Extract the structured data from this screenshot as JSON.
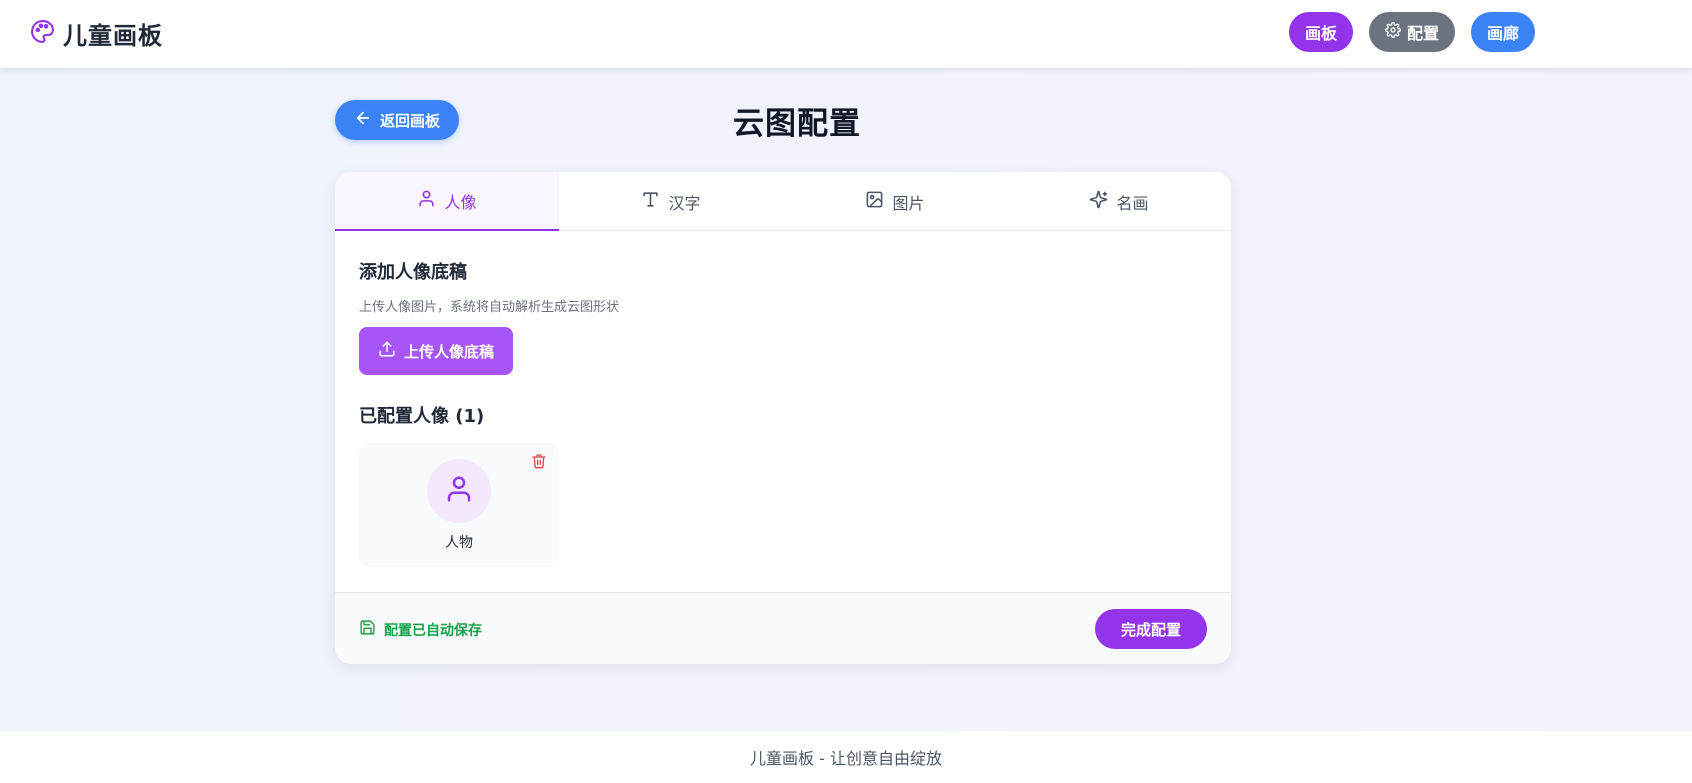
{
  "header": {
    "brand": "儿童画板",
    "nav": {
      "board": "画板",
      "config": "配置",
      "gallery": "画廊"
    }
  },
  "page": {
    "back_label": "返回画板",
    "title": "云图配置"
  },
  "tabs": [
    {
      "label": "人像",
      "icon": "user-icon",
      "active": true
    },
    {
      "label": "汉字",
      "icon": "type-icon",
      "active": false
    },
    {
      "label": "图片",
      "icon": "image-icon",
      "active": false
    },
    {
      "label": "名画",
      "icon": "sparkles-icon",
      "active": false
    }
  ],
  "portrait": {
    "add_title": "添加人像底稿",
    "add_desc": "上传人像图片，系统将自动解析生成云图形状",
    "upload_label": "上传人像底稿",
    "configured_title": "已配置人像 (1)",
    "items": [
      {
        "label": "人物"
      }
    ]
  },
  "footer_bar": {
    "saved_text": "配置已自动保存",
    "done_label": "完成配置"
  },
  "page_footer": "儿童画板 - 让创意自由绽放",
  "colors": {
    "purple": "#9333ea",
    "blue": "#3b82f6",
    "gray": "#6b7280",
    "green": "#16a34a",
    "red": "#ef4444"
  }
}
